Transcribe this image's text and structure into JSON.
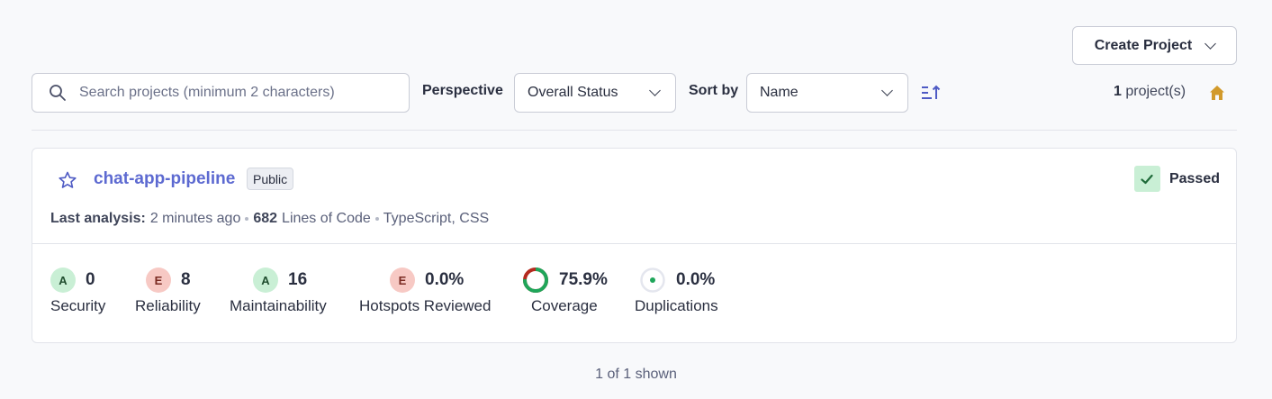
{
  "header": {
    "create_project_label": "Create Project"
  },
  "search": {
    "placeholder": "Search projects (minimum 2 characters)",
    "value": ""
  },
  "filters": {
    "perspective_label": "Perspective",
    "perspective_value": "Overall Status",
    "sort_label": "Sort by",
    "sort_value": "Name"
  },
  "project_count": {
    "number": "1",
    "suffix": "project(s)"
  },
  "project": {
    "name": "chat-app-pipeline",
    "visibility": "Public",
    "status": "Passed",
    "last_analysis_label": "Last analysis:",
    "last_analysis_value": "2 minutes ago",
    "loc_number": "682",
    "loc_label": "Lines of Code",
    "languages": "TypeScript, CSS",
    "metrics": [
      {
        "rating": "A",
        "value": "0",
        "label": "Security"
      },
      {
        "rating": "E",
        "value": "8",
        "label": "Reliability"
      },
      {
        "rating": "A",
        "value": "16",
        "label": "Maintainability"
      },
      {
        "rating": "E",
        "value": "0.0%",
        "label": "Hotspots Reviewed"
      },
      {
        "value": "75.9%",
        "label": "Coverage",
        "coverage_fraction": 0.759
      },
      {
        "value": "0.0%",
        "label": "Duplications"
      }
    ]
  },
  "footer": {
    "shown_text": "1 of 1 shown"
  },
  "colors": {
    "accent": "#5d6ad1",
    "pass_bg": "#c9efd5",
    "fail_bg": "#f7c9c4",
    "home": "#d29a2b"
  }
}
